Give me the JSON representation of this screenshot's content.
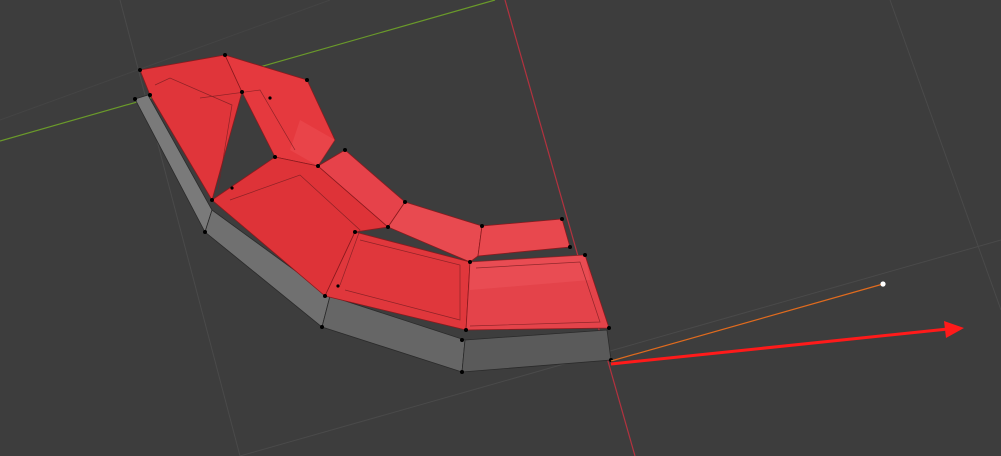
{
  "editor": {
    "type": "3D Viewport",
    "mode": "Edit Mode",
    "selection": "faces",
    "active_gizmo": "move-x-arrow"
  },
  "colors": {
    "background": "#3d3d3d",
    "grid": "#4a4a4a",
    "axis_x": "#b3323f",
    "axis_y": "#6a9a2a",
    "selected_face": "#e8383d",
    "selected_face_edge": "#8a1a1e",
    "unselected_face": "#6a6a6a",
    "vertex": "#000000",
    "gizmo_x": "#ff1a1a",
    "gizmo_line": "#e06b1e",
    "gizmo_dot": "#ffffff"
  },
  "mesh": {
    "shape": "curved-arch",
    "segments": 5,
    "selected_faces": "top",
    "thickness_visible": true
  }
}
